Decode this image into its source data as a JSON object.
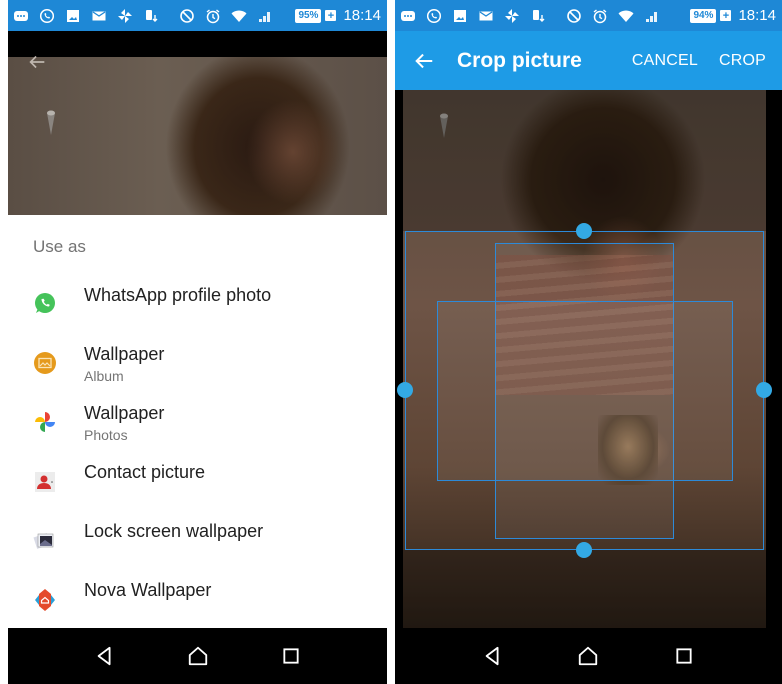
{
  "left_screen": {
    "status_bar": {
      "notification_icons": [
        "chat-bubble-icon",
        "whatsapp-icon",
        "image-icon",
        "mail-icon",
        "pinwheel-icon",
        "phone-transfer-icon"
      ],
      "system_icons": [
        "do-not-disturb-icon",
        "alarm-icon",
        "wifi-icon",
        "cell-signal-icon"
      ],
      "battery": "95%",
      "time": "18:14"
    },
    "sheet": {
      "title": "Use as",
      "items": [
        {
          "label": "WhatsApp profile photo",
          "sublabel": "",
          "icon": "whatsapp-icon"
        },
        {
          "label": "Wallpaper",
          "sublabel": "Album",
          "icon": "album-icon"
        },
        {
          "label": "Wallpaper",
          "sublabel": "Photos",
          "icon": "google-photos-icon"
        },
        {
          "label": "Contact picture",
          "sublabel": "",
          "icon": "contact-icon"
        },
        {
          "label": "Lock screen wallpaper",
          "sublabel": "",
          "icon": "lock-screen-wallpaper-icon"
        },
        {
          "label": "Nova Wallpaper",
          "sublabel": "",
          "icon": "nova-launcher-icon"
        }
      ]
    },
    "nav": [
      "back",
      "home",
      "recents"
    ]
  },
  "right_screen": {
    "status_bar": {
      "battery": "94%",
      "time": "18:14"
    },
    "app_bar": {
      "title": "Crop picture",
      "cancel": "CANCEL",
      "crop": "CROP"
    },
    "nav": [
      "back",
      "home",
      "recents"
    ]
  },
  "colors": {
    "status_bar": "#1e88d6",
    "app_bar": "#1e9be6",
    "crop_frame": "#2d8ad8",
    "crop_handle": "#33a9e4"
  }
}
